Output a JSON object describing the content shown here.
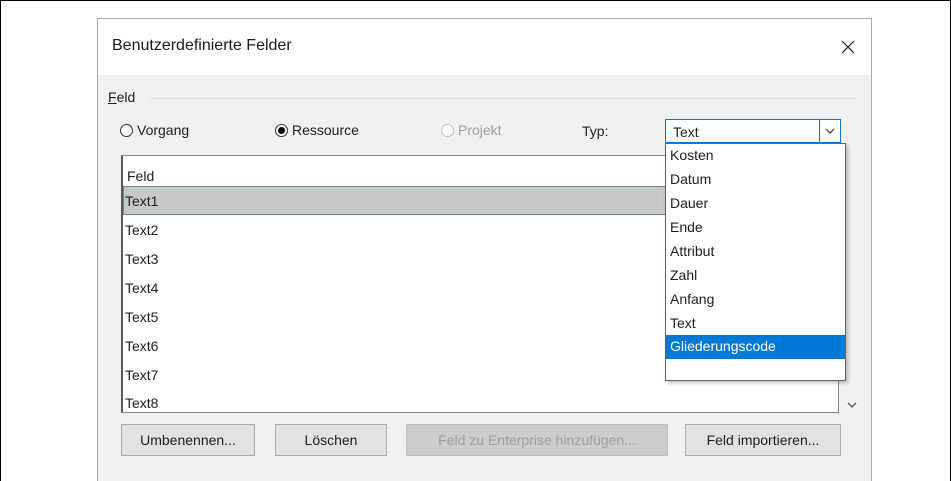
{
  "dialog": {
    "title": "Benutzerdefinierte Felder",
    "close_glyph": "✕",
    "group": {
      "label_first": "F",
      "label_rest": "eld"
    },
    "radios": [
      {
        "label": "Vorgang",
        "checked": false,
        "disabled": false
      },
      {
        "label": "Ressource",
        "checked": true,
        "disabled": false
      },
      {
        "label": "Projekt",
        "checked": false,
        "disabled": true
      }
    ],
    "type_label": "Typ:",
    "type_select": {
      "value": "Text"
    },
    "list": {
      "header": "Feld",
      "rows": [
        "Text1",
        "Text2",
        "Text3",
        "Text4",
        "Text5",
        "Text6",
        "Text7",
        "Text8"
      ],
      "selected_row": "Text1"
    },
    "dropdown": {
      "options": [
        "Kosten",
        "Datum",
        "Dauer",
        "Ende",
        "Attribut",
        "Zahl",
        "Anfang",
        "Text",
        "Gliederungscode"
      ],
      "highlighted": "Gliederungscode"
    },
    "buttons": {
      "rename": "Umbenennen...",
      "delete": "Löschen",
      "add_enterprise": "Feld zu Enterprise hinzufügen...",
      "import": "Feld importieren..."
    }
  },
  "colors": {
    "accent": "#0078d7",
    "selected_row": "#c8c8c8",
    "selected_border": "#5a9e5a"
  }
}
